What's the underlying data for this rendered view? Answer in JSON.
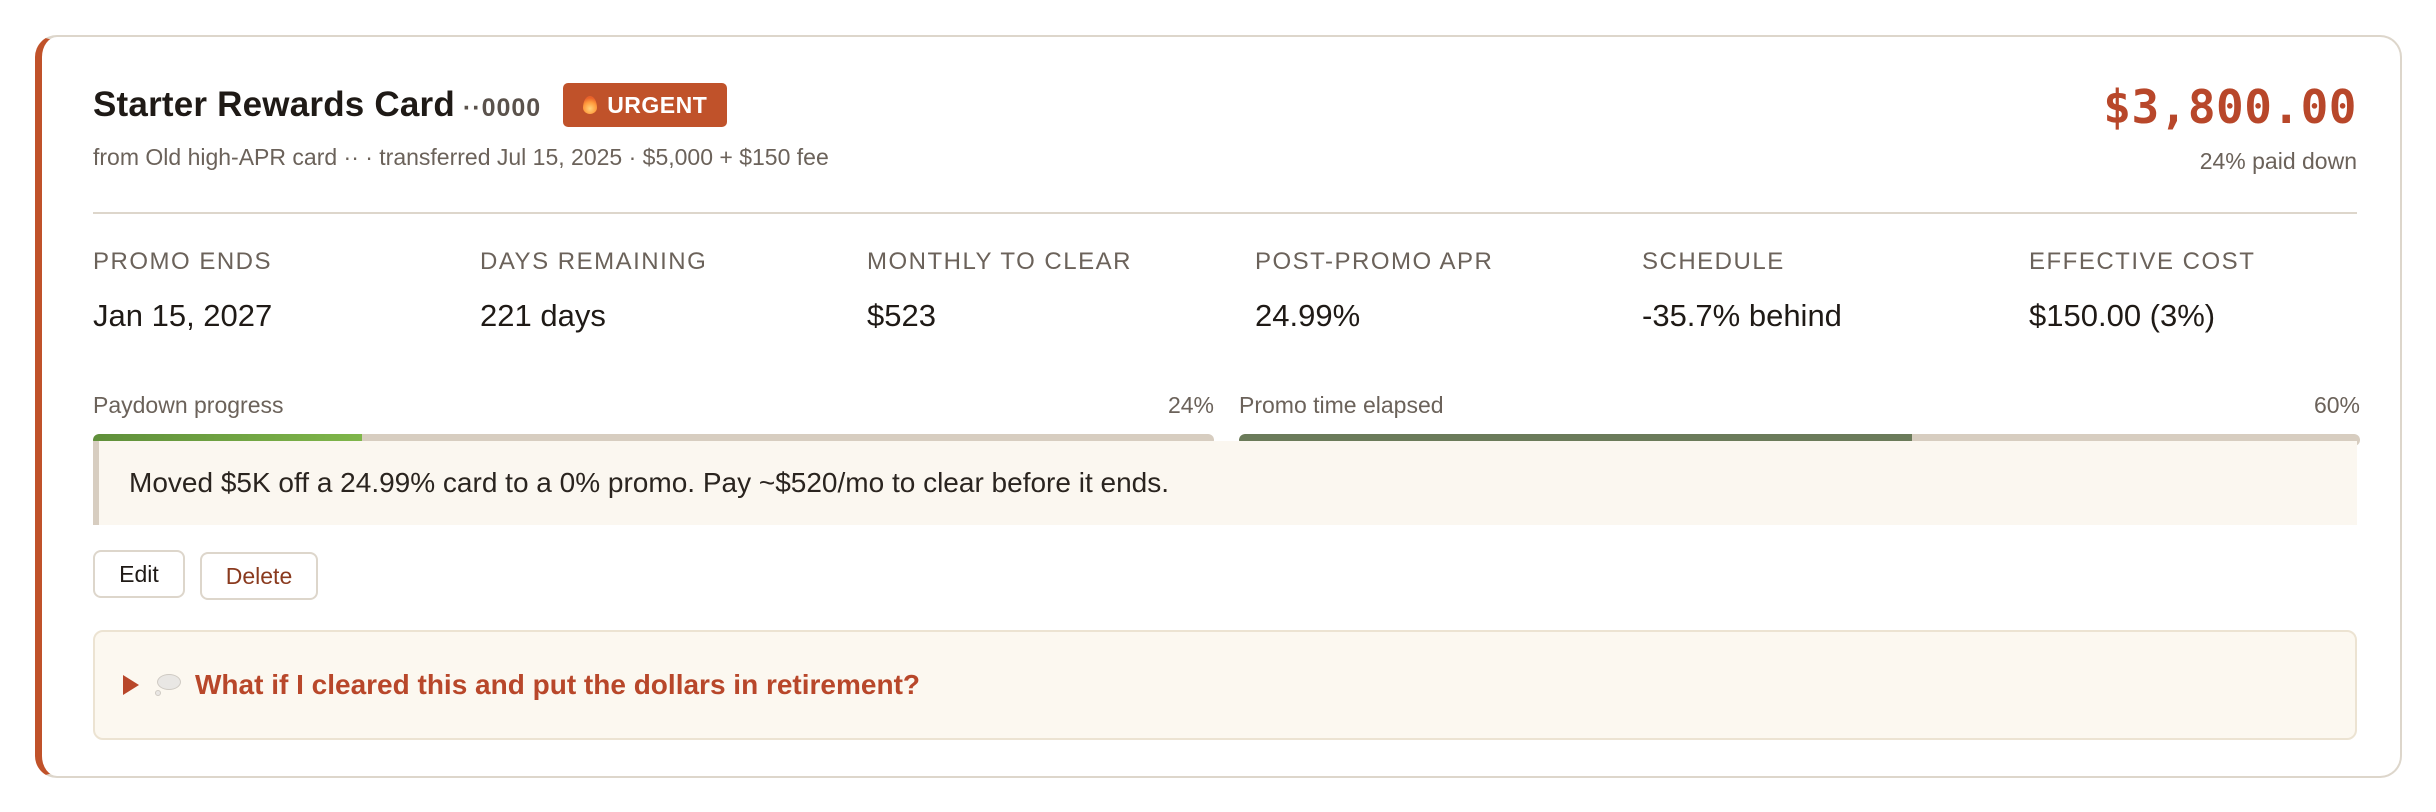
{
  "top_cut_text": "",
  "card": {
    "name": "Starter Rewards Card",
    "mask": "··0000",
    "badge": "URGENT",
    "badge_icon": "flame-icon",
    "subline": "from Old high-APR card ·· · transferred Jul 15, 2025 · $5,000 + $150 fee",
    "balance": "$3,800.00",
    "paid_down": "24% paid down"
  },
  "stats": [
    {
      "label": "PROMO ENDS",
      "value": "Jan 15, 2027"
    },
    {
      "label": "DAYS REMAINING",
      "value": "221 days"
    },
    {
      "label": "MONTHLY TO CLEAR",
      "value": "$523"
    },
    {
      "label": "POST-PROMO APR",
      "value": "24.99%"
    },
    {
      "label": "SCHEDULE",
      "value": "-35.7% behind"
    },
    {
      "label": "EFFECTIVE COST",
      "value": "$150.00 (3%)"
    }
  ],
  "progress": {
    "paydown": {
      "label": "Paydown progress",
      "value_text": "24%",
      "fraction": 0.24
    },
    "promo": {
      "label": "Promo time elapsed",
      "value_text": "60%",
      "fraction": 0.6
    }
  },
  "note": "Moved $5K off a 24.99% card to a 0% promo. Pay ~$520/mo to clear before it ends.",
  "actions": {
    "edit": "Edit",
    "delete": "Delete"
  },
  "details": {
    "icon": "thought-bubble-icon",
    "label": "What if I cleared this and put the dollars in retirement?"
  },
  "colors": {
    "accent": "#c0522a",
    "balance": "#b8472a",
    "paydown_fill_start": "#5f8f3a",
    "paydown_fill_end": "#7fb64a",
    "promo_fill": "#6b7b5a",
    "track": "#d7cdc0"
  }
}
